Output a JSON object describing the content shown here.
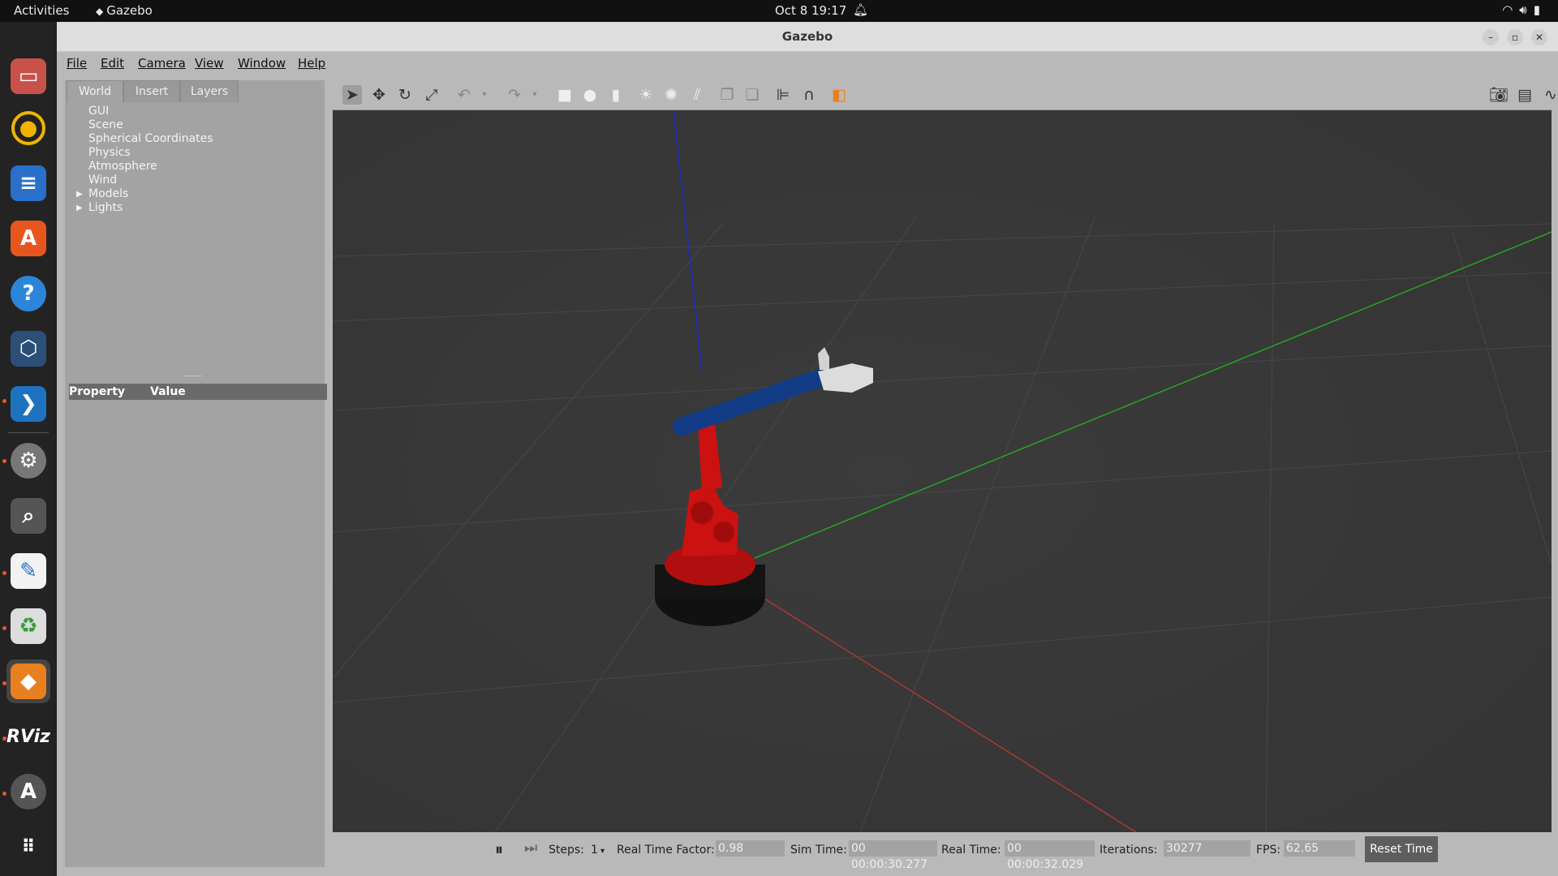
{
  "topbar": {
    "activities": "Activities",
    "app_name": "Gazebo",
    "clock": "Oct 8  19:17"
  },
  "window": {
    "title": "Gazebo"
  },
  "menu": [
    "File",
    "Edit",
    "Camera",
    "View",
    "Window",
    "Help"
  ],
  "left_panel": {
    "tabs": [
      "World",
      "Insert",
      "Layers"
    ],
    "active_tab": "World",
    "tree": [
      "GUI",
      "Scene",
      "Spherical Coordinates",
      "Physics",
      "Atmosphere",
      "Wind"
    ],
    "expandable": [
      "Models",
      "Lights"
    ],
    "property_header": "Property",
    "value_header": "Value"
  },
  "status": {
    "steps_label": "Steps:",
    "steps_value": "1",
    "rtf_label": "Real Time Factor:",
    "rtf_value": "0.98",
    "sim_label": "Sim Time:",
    "sim_value": "00 00:00:30.277",
    "real_label": "Real Time:",
    "real_value": "00 00:00:32.029",
    "iter_label": "Iterations:",
    "iter_value": "30277",
    "fps_label": "FPS:",
    "fps_value": "62.65",
    "reset_label": "Reset Time"
  },
  "dock_icons": [
    "files-icon",
    "rhythmbox-icon",
    "writer-icon",
    "app-center-icon",
    "help-icon",
    "virtualbox-icon",
    "vscode-icon",
    "settings-icon",
    "search-icon",
    "text-editor-icon",
    "trash-icon",
    "gazebo-icon",
    "rviz-icon",
    "software-updater-icon",
    "show-apps-icon"
  ],
  "dock_labels": {
    "rviz": "RViz"
  },
  "colors": {
    "axis_x": "#c0392b",
    "axis_y": "#27a327",
    "axis_z": "#1f2fa8",
    "robot_base": "#cc1111",
    "robot_arm": "#123c86"
  }
}
